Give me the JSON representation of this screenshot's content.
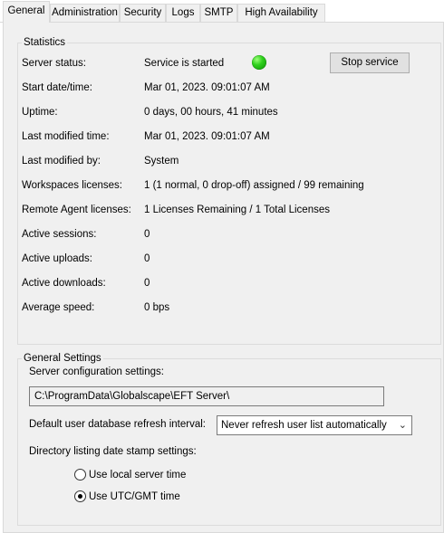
{
  "tabs": [
    {
      "label": "General",
      "active": true
    },
    {
      "label": "Administration"
    },
    {
      "label": "Security"
    },
    {
      "label": "Logs"
    },
    {
      "label": "SMTP"
    },
    {
      "label": "High Availability"
    }
  ],
  "statistics": {
    "title": "Statistics",
    "server_status_label": "Server status:",
    "server_status_value": "Service is started",
    "status_color": "#2fd11c",
    "stop_button": "Stop service",
    "rows": [
      {
        "label": "Start date/time:",
        "value": "Mar 01, 2023. 09:01:07 AM"
      },
      {
        "label": "Uptime:",
        "value": "0 days, 00 hours, 41 minutes"
      },
      {
        "label": "Last modified time:",
        "value": "Mar 01, 2023. 09:01:07 AM"
      },
      {
        "label": "Last modified by:",
        "value": "System"
      },
      {
        "label": "Workspaces licenses:",
        "value": "1 (1 normal, 0 drop-off) assigned / 99 remaining"
      },
      {
        "label": "Remote Agent licenses:",
        "value": "1 Licenses Remaining / 1 Total Licenses"
      },
      {
        "label": "Active sessions:",
        "value": "0"
      },
      {
        "label": "Active uploads:",
        "value": "0"
      },
      {
        "label": "Active downloads:",
        "value": "0"
      },
      {
        "label": "Average speed:",
        "value": "0 bps"
      }
    ]
  },
  "general_settings": {
    "title": "General Settings",
    "config_label": "Server configuration settings:",
    "config_path": "C:\\ProgramData\\Globalscape\\EFT Server\\",
    "refresh_label": "Default user database refresh interval:",
    "refresh_value": "Never refresh user list automatically",
    "dir_label": "Directory listing date stamp settings:",
    "radio_local": "Use local server time",
    "radio_utc": "Use UTC/GMT time",
    "selected": "utc"
  }
}
